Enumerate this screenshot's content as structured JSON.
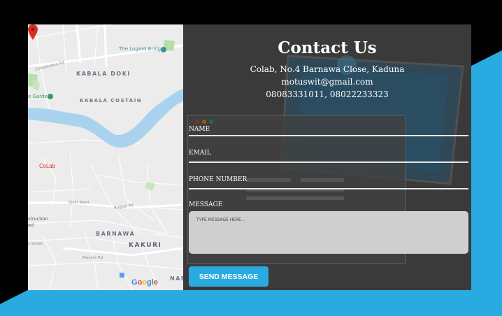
{
  "colors": {
    "accent": "#29abe2",
    "panel_bg": "#3a3a3a",
    "map_bg": "#ececec",
    "river": "#a8d2ee"
  },
  "map": {
    "labels": {
      "lugard_bridge": "The Lugard Bridge",
      "kabala_doki": "KABALA DOKI",
      "kabala_costain": "KABALA COSTAIN",
      "garden": "e Garden",
      "colab": "CoLab",
      "barnawa": "BARNAWA",
      "kakuri": "KAKURI",
      "nar": "NAR",
      "constitution_rd": "Constitution Rd",
      "ejoiti_road": "Ejoiti Road",
      "bugaje_rd": "Bugaje Rd",
      "mayere_rd": "Mayere Rd",
      "struction": "struction",
      "ed": "ed",
      "s_street": "s Street",
      "google": "Google"
    },
    "icons": {
      "pin": "location-pin-icon",
      "bridge": "bridge-marker-icon",
      "garden": "garden-marker-icon"
    }
  },
  "contact": {
    "title": "Contact Us",
    "address": "Colab, No.4 Barnawa Close, Kaduna",
    "email": "motuswit@gmail.com",
    "phones": "08083331011, 08022233323"
  },
  "form": {
    "name_label": "NAME",
    "email_label": "EMAIL",
    "phone_label": "PHONE NUMBER",
    "message_label": "MESSAGE",
    "message_placeholder": "TYPE MESSAGE HERE...",
    "send_label": "SEND MESSAGE"
  }
}
